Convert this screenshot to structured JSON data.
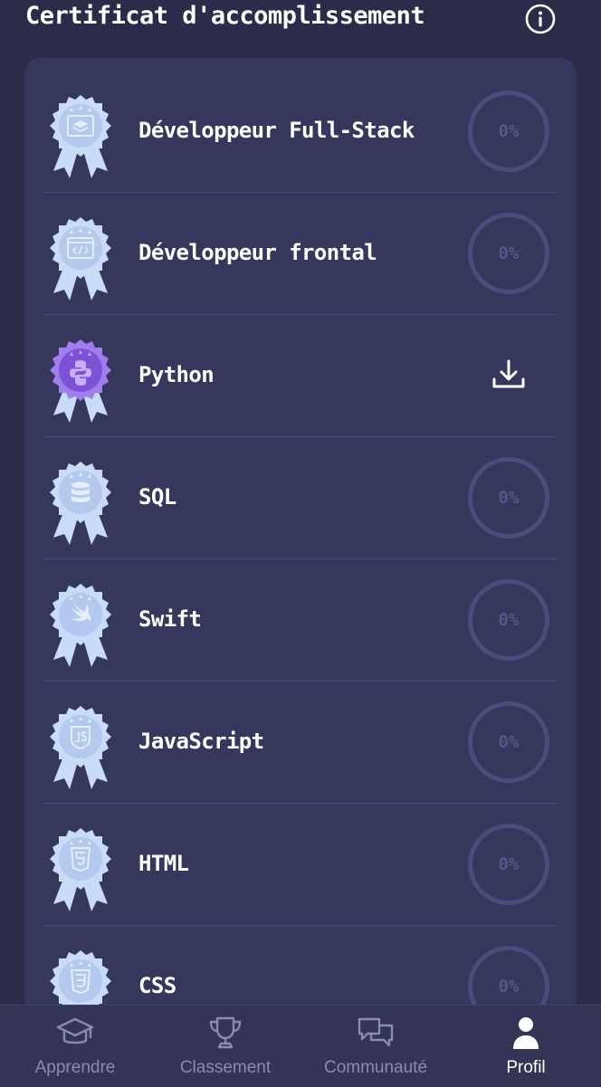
{
  "header": {
    "title": "Certificat d'accomplissement",
    "info_icon": "info-circle-icon"
  },
  "certificates": [
    {
      "name": "Développeur Full-Stack",
      "icon": "layers-icon",
      "status": "progress",
      "progress": "0%"
    },
    {
      "name": "Développeur frontal",
      "icon": "code-window-icon",
      "status": "progress",
      "progress": "0%"
    },
    {
      "name": "Python",
      "icon": "python-icon",
      "status": "completed",
      "action_icon": "download-icon"
    },
    {
      "name": "SQL",
      "icon": "database-icon",
      "status": "progress",
      "progress": "0%"
    },
    {
      "name": "Swift",
      "icon": "swift-icon",
      "status": "progress",
      "progress": "0%"
    },
    {
      "name": "JavaScript",
      "icon": "js-icon",
      "status": "progress",
      "progress": "0%"
    },
    {
      "name": "HTML",
      "icon": "html5-icon",
      "status": "progress",
      "progress": "0%"
    },
    {
      "name": "CSS",
      "icon": "css3-icon",
      "status": "progress",
      "progress": "0%"
    }
  ],
  "nav": {
    "items": [
      {
        "label": "Apprendre",
        "icon": "graduation-cap-icon",
        "active": false
      },
      {
        "label": "Classement",
        "icon": "trophy-icon",
        "active": false
      },
      {
        "label": "Communauté",
        "icon": "chat-bubbles-icon",
        "active": false
      },
      {
        "label": "Profil",
        "icon": "user-icon",
        "active": true
      }
    ]
  },
  "colors": {
    "background": "#2b2b4a",
    "card": "#36375c",
    "badge_locked": "#c9dcf7",
    "badge_unlocked": "#a07ef0",
    "progress_ring": "#4b4c7c",
    "nav_inactive": "#8a8caf",
    "nav_active": "#ffffff"
  }
}
